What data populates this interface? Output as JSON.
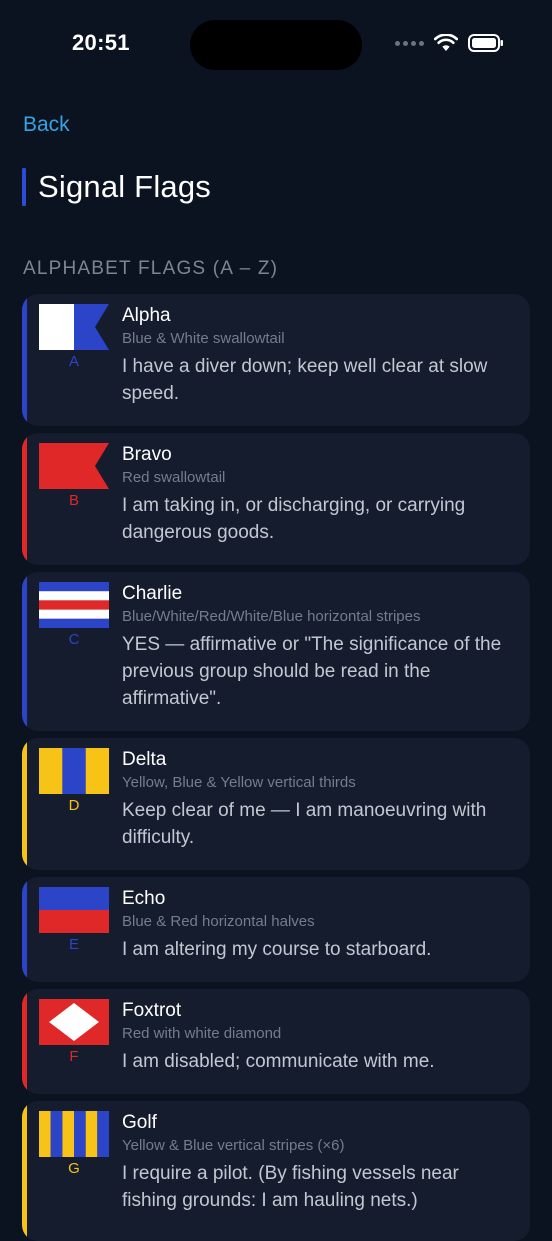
{
  "status_bar": {
    "time": "20:51"
  },
  "nav": {
    "back_label": "Back"
  },
  "page": {
    "title": "Signal Flags",
    "section_header": "ALPHABET FLAGS (A – Z)",
    "title_accent_color": "#2b4bd8"
  },
  "colors": {
    "background": "#0b1220",
    "card": "#141c2e",
    "link": "#33a4e6",
    "blue_accent": "#2b44c8",
    "red_accent": "#e02828",
    "yellow_accent": "#f7c317"
  },
  "flags": [
    {
      "letter": "A",
      "name": "Alpha",
      "description": "Blue & White swallowtail",
      "meaning": "I have a diver down; keep well clear at slow speed.",
      "accent": "#2b44c8"
    },
    {
      "letter": "B",
      "name": "Bravo",
      "description": "Red swallowtail",
      "meaning": "I am taking in, or discharging, or carrying dangerous goods.",
      "accent": "#e02828"
    },
    {
      "letter": "C",
      "name": "Charlie",
      "description": "Blue/White/Red/White/Blue horizontal stripes",
      "meaning": "YES — affirmative or \"The significance of the previous group should be read in the affirmative\".",
      "accent": "#2b44c8"
    },
    {
      "letter": "D",
      "name": "Delta",
      "description": "Yellow, Blue & Yellow vertical thirds",
      "meaning": "Keep clear of me — I am manoeuvring with difficulty.",
      "accent": "#f7c317"
    },
    {
      "letter": "E",
      "name": "Echo",
      "description": "Blue & Red horizontal halves",
      "meaning": "I am altering my course to starboard.",
      "accent": "#2b44c8"
    },
    {
      "letter": "F",
      "name": "Foxtrot",
      "description": "Red with white diamond",
      "meaning": "I am disabled; communicate with me.",
      "accent": "#e02828"
    },
    {
      "letter": "G",
      "name": "Golf",
      "description": "Yellow & Blue vertical stripes (×6)",
      "meaning": "I require a pilot. (By fishing vessels near fishing grounds: I am hauling nets.)",
      "accent": "#f7c317"
    }
  ]
}
